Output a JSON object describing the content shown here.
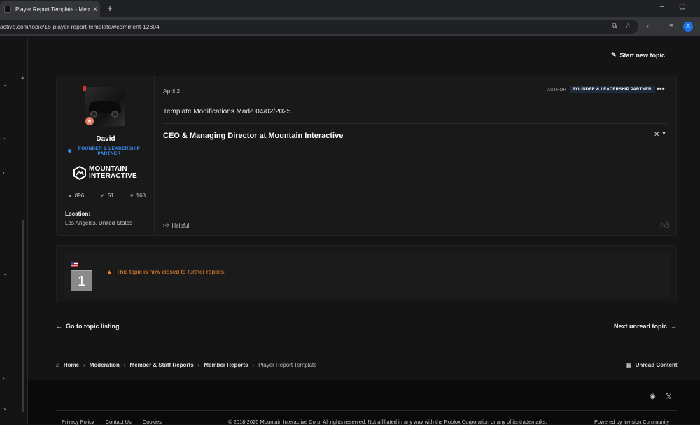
{
  "browser": {
    "tab_title": "Player Report Template - Mem",
    "tab_close": "✕",
    "new_tab": "+",
    "url": "active.com/topic/16-player-report-template/#comment-12804",
    "profile_initial": "A",
    "min": "–",
    "max": "▢"
  },
  "header": {
    "start_topic": "Start new topic"
  },
  "post": {
    "author": {
      "name": "David",
      "group": "FOUNDER & LEADERSHIP PARTNER",
      "logo_line1": "MOUNTAIN",
      "logo_line2": "INTERACTIVE",
      "stats": {
        "posts": "896",
        "solutions": "51",
        "reputation": "168"
      },
      "location_label": "Location:",
      "location_value": "Los Angeles, United States"
    },
    "date": "April 2",
    "badge_author": "AUTHOR",
    "badge_group": "FOUNDER & LEADERSHIP PARTNER",
    "menu": "•••",
    "content": "Template Modifications Made 04/02/2025.",
    "signature": "CEO & Managing Director at Mountain Interactive",
    "helpful_label": "Helpful"
  },
  "closed": {
    "number": "1",
    "message": "This topic is now closed to further replies."
  },
  "nav": {
    "prev": "Go to topic listing",
    "next": "Next unread topic"
  },
  "breadcrumb": {
    "items": [
      "Home",
      "Moderation",
      "Member & Staff Reports",
      "Member Reports",
      "Player Report Template"
    ],
    "unread": "Unread Content"
  },
  "footer": {
    "links": [
      "Privacy Policy",
      "Contact Us",
      "Cookies"
    ],
    "copyright": "© 2018-2025 Mountain Interactive Corp. All rights reserved. Not affiliated in any way with the Roblox Corporation or any of its trademarks.",
    "powered": "Powered by Invision Community"
  },
  "colors": {
    "group_blue": "#3b8ff5",
    "warning_orange": "#f0892e",
    "background": "#141414"
  }
}
